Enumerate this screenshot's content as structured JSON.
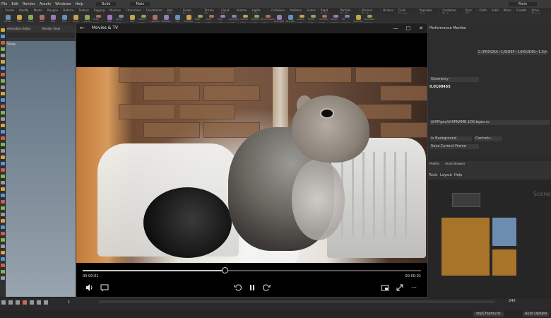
{
  "houdini": {
    "menu": [
      "File",
      "Edit",
      "Render",
      "Assets",
      "Windows",
      "Help"
    ],
    "desktop": "Build",
    "main_label": "Main",
    "viewport_label": "View",
    "pane_tabs": [
      "Animation Editor",
      "Render View"
    ],
    "shelf_tabs": [
      "Create",
      "Modify",
      "Model",
      "Polygon",
      "Deform",
      "Texture",
      "Rigging",
      "Muscles",
      "Characters",
      "Constraints",
      "Hair Utils",
      "Guide Process",
      "Terrain FX",
      "Cloud FX",
      "Volume",
      "Lights and...",
      "Collisions",
      "Particles",
      "Grains",
      "Rigid Bodies",
      "Particle Fluids",
      "Viscous Fluids",
      "Oceans",
      "Fluid Contai...",
      "Populate Con...",
      "Container Tools",
      "Pyro FX",
      "Cloth",
      "Solid",
      "Wires",
      "Crowds",
      "Drive Simula..."
    ],
    "shelf_icons": [
      "Sphere",
      "Tube",
      "Torus",
      "Grid",
      "Null",
      "Line",
      "Circle",
      "Curve",
      "Draw Curve",
      "Path",
      "Spray Paint",
      "Font",
      "Platonic Solids",
      "L-System",
      "Metaball",
      "File",
      "Camera",
      "Point Light",
      "Spot Light",
      "Area Light",
      "Geometry Light",
      "Volume Light",
      "Distant Light",
      "Environment Light",
      "Sky Light",
      "GI Light",
      "Caustic Light",
      "Portal Light",
      "Ambient Light",
      "Stereo Camera",
      "VR Camera",
      "Switcher",
      "Gamepad Camera"
    ],
    "perf_monitor": "Performance Monitor",
    "right_fields": [
      "C:/PROGRA~1/SIDEF~1/HOUDIN~1.5/houdini",
      "Geometry",
      "$HIP/geo/$HIPNAME.$OS.bgeo.sc",
      "in Background",
      "Controls...",
      "Save Current Frame"
    ],
    "right_value": "0.0100455",
    "net_tabs": [
      "Palette",
      "Asset Browser"
    ],
    "net_menu": [
      "Tools",
      "Layout",
      "Help"
    ],
    "net_title": "Scene",
    "frame": "1",
    "frame_end": "240",
    "status_text": "obj/Chipmunk",
    "auto_update": "Auto Update"
  },
  "player": {
    "app_title": "Movies & TV",
    "back_icon": "back-arrow-icon",
    "time_elapsed": "00:00:01",
    "time_remaining": "00:00:01",
    "progress": 0.42,
    "state": "playing"
  }
}
